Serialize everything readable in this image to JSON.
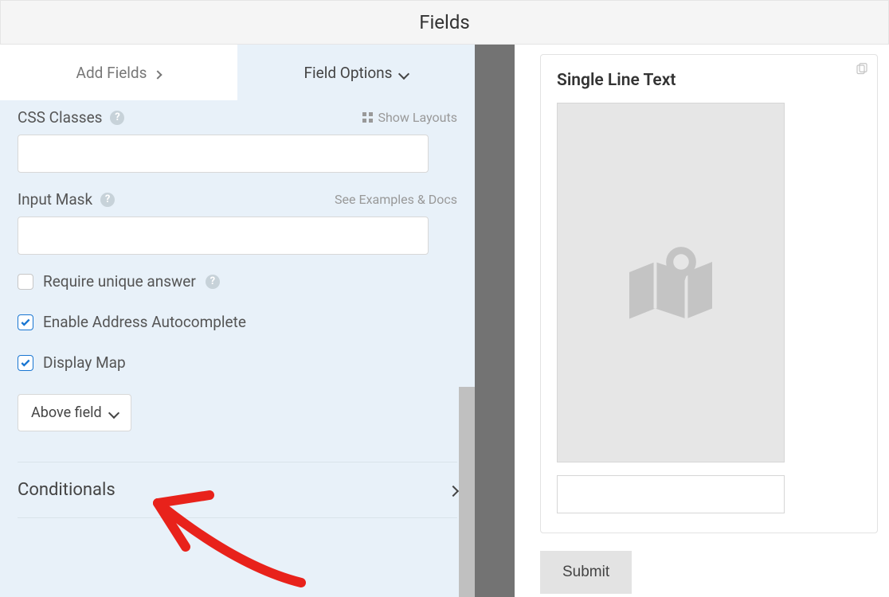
{
  "header": {
    "title": "Fields"
  },
  "tabs": {
    "add": "Add Fields",
    "options": "Field Options"
  },
  "options": {
    "css_classes": {
      "label": "CSS Classes",
      "show_layouts": "Show Layouts",
      "value": ""
    },
    "input_mask": {
      "label": "Input Mask",
      "hint": "See Examples & Docs",
      "value": ""
    },
    "require_unique": {
      "label": "Require unique answer",
      "checked": false
    },
    "enable_autocomplete": {
      "label": "Enable Address Autocomplete",
      "checked": true
    },
    "display_map": {
      "label": "Display Map",
      "checked": true,
      "position": "Above field"
    },
    "conditionals": {
      "label": "Conditionals"
    }
  },
  "preview": {
    "field_title": "Single Line Text",
    "submit": "Submit"
  }
}
